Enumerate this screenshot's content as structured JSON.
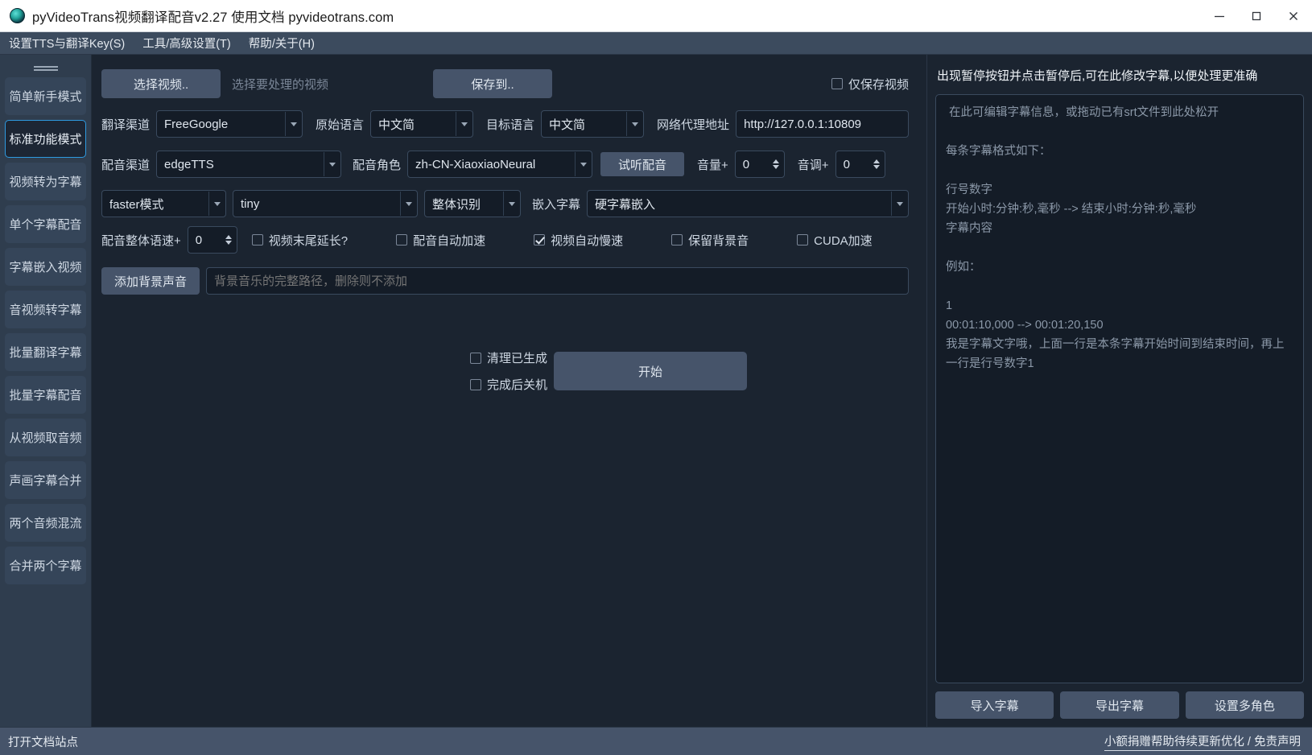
{
  "window": {
    "title": "pyVideoTrans视频翻译配音v2.27  使用文档  pyvideotrans.com",
    "minimize": "−",
    "maximize": "□",
    "close": "✕"
  },
  "menubar": {
    "items": [
      {
        "label": "设置TTS与翻译Key(S)"
      },
      {
        "label": "工具/高级设置(T)"
      },
      {
        "label": "帮助/关于(H)"
      }
    ]
  },
  "sidebar": {
    "items": [
      {
        "label": "简单新手模式",
        "active": false
      },
      {
        "label": "标准功能模式",
        "active": true
      },
      {
        "label": "视频转为字幕",
        "active": false
      },
      {
        "label": "单个字幕配音",
        "active": false
      },
      {
        "label": "字幕嵌入视频",
        "active": false
      },
      {
        "label": "音视频转字幕",
        "active": false
      },
      {
        "label": "批量翻译字幕",
        "active": false
      },
      {
        "label": "批量字幕配音",
        "active": false
      },
      {
        "label": "从视频取音频",
        "active": false
      },
      {
        "label": "声画字幕合并",
        "active": false
      },
      {
        "label": "两个音频混流",
        "active": false
      },
      {
        "label": "合并两个字幕",
        "active": false
      }
    ]
  },
  "main": {
    "row1": {
      "select_video_button": "选择视频..",
      "select_video_hint": "选择要处理的视频",
      "save_to_button": "保存到..",
      "only_save_video_checkbox": "仅保存视频",
      "only_save_video_checked": false
    },
    "row2": {
      "translate_channel_label": "翻译渠道",
      "translate_channel_value": "FreeGoogle",
      "source_language_label": "原始语言",
      "source_language_value": "中文简",
      "target_language_label": "目标语言",
      "target_language_value": "中文简",
      "proxy_label": "网络代理地址",
      "proxy_value": "http://127.0.0.1:10809"
    },
    "row3": {
      "tts_channel_label": "配音渠道",
      "tts_channel_value": "edgeTTS",
      "tts_role_label": "配音角色",
      "tts_role_value": "zh-CN-XiaoxiaoNeural",
      "preview_button": "试听配音",
      "volume_label": "音量+",
      "volume_value": "0",
      "pitch_label": "音调+",
      "pitch_value": "0"
    },
    "row4": {
      "model_mode_value": "faster模式",
      "model_size_value": "tiny",
      "recognize_mode_value": "整体识别",
      "embed_subtitle_label": "嵌入字幕",
      "embed_subtitle_value": "硬字幕嵌入"
    },
    "row5": {
      "speed_label": "配音整体语速+",
      "speed_value": "0",
      "checkboxes": [
        {
          "label": "视频末尾延长?",
          "checked": false
        },
        {
          "label": "配音自动加速",
          "checked": false
        },
        {
          "label": "视频自动慢速",
          "checked": true
        },
        {
          "label": "保留背景音",
          "checked": false
        },
        {
          "label": "CUDA加速",
          "checked": false
        }
      ]
    },
    "row6": {
      "add_bgm_button": "添加背景声音",
      "bgm_placeholder": "背景音乐的完整路径，删除则不添加"
    },
    "start_area": {
      "clear_generated_checkbox": "清理已生成",
      "clear_generated_checked": false,
      "shutdown_checkbox": "完成后关机",
      "shutdown_checked": false,
      "start_button": "开始"
    }
  },
  "right_panel": {
    "title": "出现暂停按钮并点击暂停后,可在此修改字幕,以便处理更准确",
    "editor_text": " 在此可编辑字幕信息，或拖动已有srt文件到此处松开\n\n每条字幕格式如下：\n\n行号数字\n开始小时:分钟:秒,毫秒 --> 结束小时:分钟:秒,毫秒\n字幕内容\n\n例如：\n\n1\n00:01:10,000 --> 00:01:20,150\n我是字幕文字哦，上面一行是本条字幕开始时间到结束时间，再上一行是行号数字1",
    "buttons": [
      {
        "label": "导入字幕"
      },
      {
        "label": "导出字幕"
      },
      {
        "label": "设置多角色"
      }
    ]
  },
  "statusbar": {
    "left": "打开文档站点",
    "right": "小额捐赠帮助待续更新优化 / 免责声明"
  }
}
